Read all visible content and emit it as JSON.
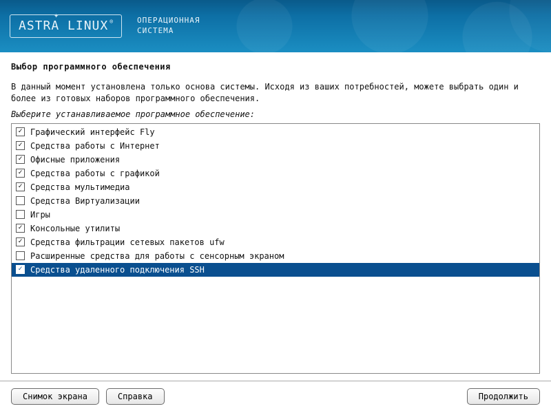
{
  "header": {
    "logo_text": "ASTRA LINUX",
    "subtitle_line1": "ОПЕРАЦИОННАЯ",
    "subtitle_line2": "СИСТЕМА"
  },
  "title": "Выбор программного обеспечения",
  "description": "В данный момент установлена только основа системы. Исходя из ваших потребностей, можете выбрать один и более из готовых наборов программного обеспечения.",
  "prompt": "Выберите устанавливаемое программное обеспечение:",
  "items": [
    {
      "label": "Графический интерфейс Fly",
      "checked": true,
      "selected": false
    },
    {
      "label": "Средства работы с Интернет",
      "checked": true,
      "selected": false
    },
    {
      "label": "Офисные приложения",
      "checked": true,
      "selected": false
    },
    {
      "label": "Средства работы с графикой",
      "checked": true,
      "selected": false
    },
    {
      "label": "Средства мультимедиа",
      "checked": true,
      "selected": false
    },
    {
      "label": "Средства Виртуализации",
      "checked": false,
      "selected": false
    },
    {
      "label": "Игры",
      "checked": false,
      "selected": false
    },
    {
      "label": "Консольные утилиты",
      "checked": true,
      "selected": false
    },
    {
      "label": "Средства фильтрации сетевых пакетов ufw",
      "checked": true,
      "selected": false
    },
    {
      "label": "Расширенные средства для работы с сенсорным экраном",
      "checked": false,
      "selected": false
    },
    {
      "label": "Средства удаленного подключения SSH",
      "checked": true,
      "selected": true
    }
  ],
  "buttons": {
    "screenshot": "Снимок экрана",
    "help": "Справка",
    "continue": "Продолжить"
  }
}
